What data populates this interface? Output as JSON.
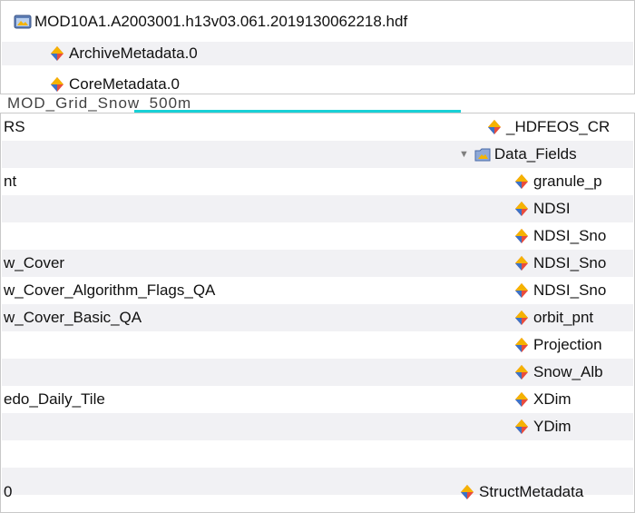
{
  "file": {
    "name": "MOD10A1.A2003001.h13v03.061.2019130062218.hdf"
  },
  "file_children": [
    {
      "label": "ArchiveMetadata.0"
    },
    {
      "label": "CoreMetadata.0"
    }
  ],
  "garbled_row": {
    "text": "MOD_Grid_Snow_500m"
  },
  "left_column": [
    {
      "label": "RS"
    },
    {
      "label": ""
    },
    {
      "label": "nt"
    },
    {
      "label": ""
    },
    {
      "label": "w_Cover"
    },
    {
      "label": "w_Cover_Algorithm_Flags_QA"
    },
    {
      "label": "w_Cover_Basic_QA"
    },
    {
      "label": ""
    },
    {
      "label": ""
    },
    {
      "label": "edo_Daily_Tile"
    },
    {
      "label": ""
    },
    {
      "label": ""
    },
    {
      "label": "0"
    }
  ],
  "right_column": {
    "hdfeos": "_HDFEOS_CR",
    "data_fields": "Data_Fields",
    "fields": [
      "granule_p",
      "NDSI",
      "NDSI_Sno",
      "NDSI_Sno",
      "NDSI_Sno",
      "orbit_pnt",
      "Projection",
      "Snow_Alb",
      "XDim",
      "YDim"
    ],
    "struct": "StructMetadata"
  },
  "icons": {
    "attr": "attribute-icon",
    "folder": "folder-icon",
    "file": "hdf-file-icon",
    "toggle": "disclosure-triangle-icon"
  }
}
